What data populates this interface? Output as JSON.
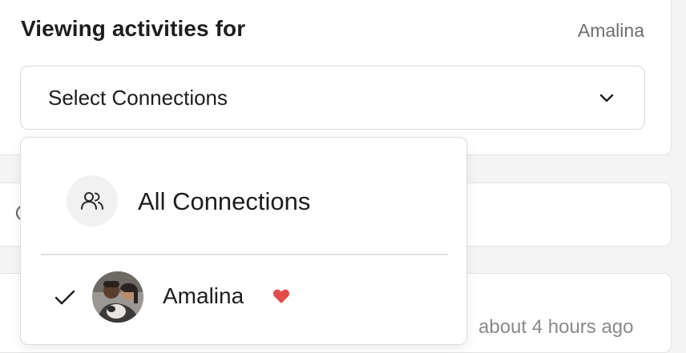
{
  "header": {
    "title": "Viewing activities for",
    "current_user": "Amalina"
  },
  "select": {
    "label": "Select Connections",
    "icon": "chevron-down-icon"
  },
  "dropdown": {
    "all_option": {
      "label": "All Connections",
      "icon": "users-icon"
    },
    "connections": [
      {
        "name": "Amalina",
        "selected": true,
        "favorite": true,
        "favorite_color": "#e24c4b"
      }
    ]
  },
  "feed": {
    "timestamp_partial": "about 4 hours ago"
  },
  "colors": {
    "background": "#f4f4f4",
    "card": "#ffffff",
    "border": "#e3e3e3",
    "text": "#1d1d1d",
    "muted": "#6f6f6f",
    "heart": "#e24c4b"
  }
}
